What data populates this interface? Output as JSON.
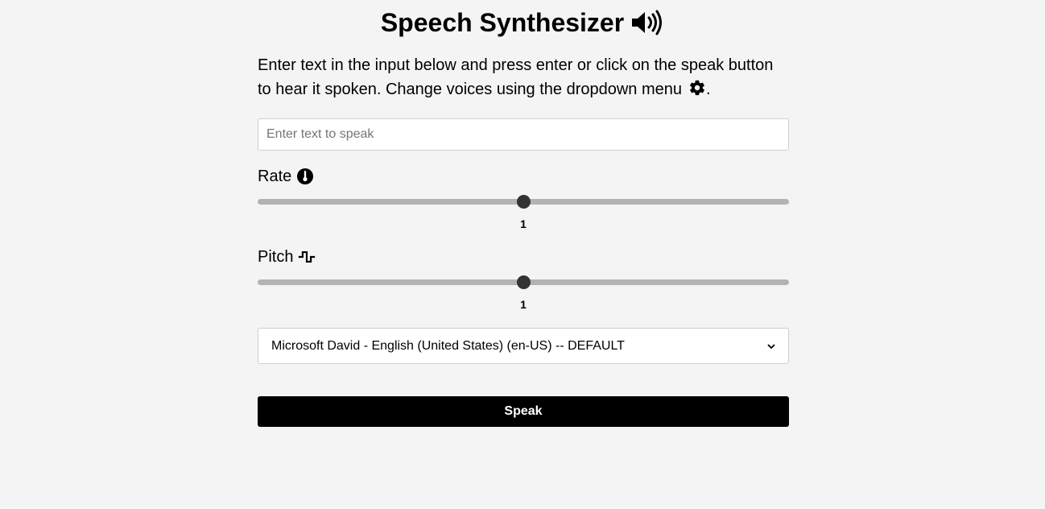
{
  "header": {
    "title": "Speech Synthesizer",
    "title_icon": "speaker-volume-icon"
  },
  "intro": {
    "text": "Enter text in the input below and press enter or click on the speak button to hear it spoken. Change voices using the dropdown menu",
    "icon": "gear-icon",
    "trailing": "."
  },
  "text_input": {
    "placeholder": "Enter text to speak",
    "value": ""
  },
  "rate": {
    "label": "Rate",
    "icon": "thermometer-icon",
    "value": "1",
    "min": 0.5,
    "max": 1.5,
    "current": 1
  },
  "pitch": {
    "label": "Pitch",
    "icon": "square-wave-icon",
    "value": "1",
    "min": 0,
    "max": 2,
    "current": 1
  },
  "voice_select": {
    "selected": "Microsoft David - English (United States) (en-US) -- DEFAULT"
  },
  "speak_button": {
    "label": "Speak"
  },
  "colors": {
    "background": "#f4f4f4",
    "button": "#000000",
    "track": "#b3b3b3",
    "thumb": "#333333"
  }
}
